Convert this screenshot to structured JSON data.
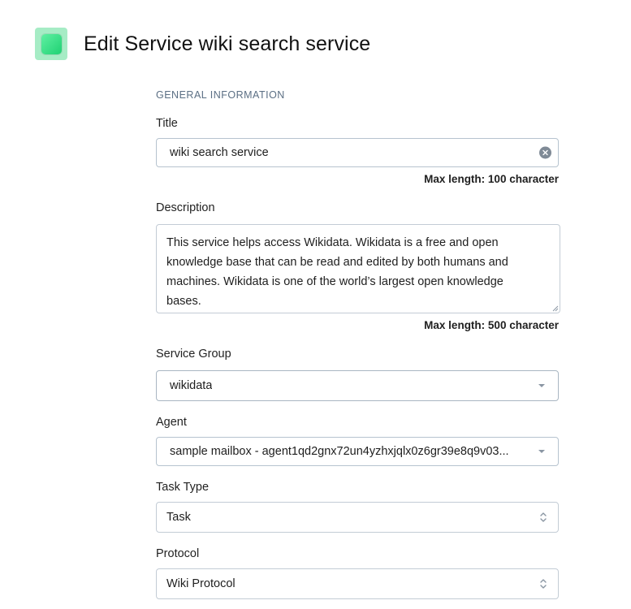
{
  "header": {
    "title": "Edit Service wiki search service"
  },
  "form": {
    "section_heading": "GENERAL INFORMATION",
    "title": {
      "label": "Title",
      "value": "wiki search service",
      "helper": "Max length: 100 character"
    },
    "description": {
      "label": "Description",
      "value": "This service helps access Wikidata. Wikidata is a free and open knowledge base that can be read and edited by both humans and machines. Wikidata is one of the world’s largest open knowledge bases.",
      "helper": "Max length: 500 character"
    },
    "service_group": {
      "label": "Service Group",
      "value": "wikidata"
    },
    "agent": {
      "label": "Agent",
      "value": "sample mailbox - agent1qd2gnx72un4yzhxjqlx0z6gr39e8q9v03..."
    },
    "task_type": {
      "label": "Task Type",
      "value": "Task"
    },
    "protocol": {
      "label": "Protocol",
      "value": "Wiki Protocol"
    }
  }
}
